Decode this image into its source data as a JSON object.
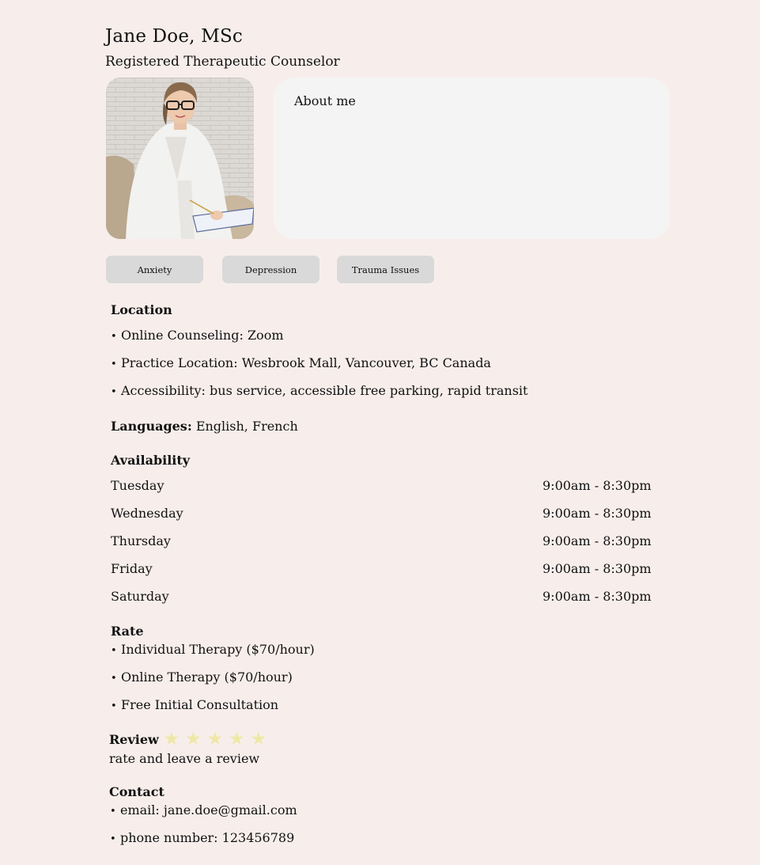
{
  "header": {
    "name": "Jane Doe, MSc",
    "title": "Registered Therapeutic Counselor"
  },
  "about": {
    "heading": "About me"
  },
  "tags": [
    "Anxiety",
    "Depression",
    "Trauma Issues"
  ],
  "location": {
    "heading": "Location",
    "items": [
      "Online Counseling: Zoom",
      "Practice Location: Wesbrook Mall, Vancouver, BC Canada",
      "Accessibility: bus service, accessible free parking, rapid transit"
    ]
  },
  "languages": {
    "label": "Languages:",
    "value": "English, French"
  },
  "availability": {
    "heading": "Availability",
    "rows": [
      {
        "day": "Tuesday",
        "hours": "9:00am - 8:30pm"
      },
      {
        "day": "Wednesday",
        "hours": "9:00am - 8:30pm"
      },
      {
        "day": "Thursday",
        "hours": "9:00am - 8:30pm"
      },
      {
        "day": "Friday",
        "hours": "9:00am - 8:30pm"
      },
      {
        "day": "Saturday",
        "hours": "9:00am - 8:30pm"
      }
    ]
  },
  "rate": {
    "heading": "Rate",
    "items": [
      "Individual Therapy ($70/hour)",
      "Online Therapy ($70/hour)",
      "Free Initial Consultation"
    ]
  },
  "review": {
    "heading": "Review",
    "star_glyph": "★",
    "star_count": 5,
    "star_color": "#efe7a6",
    "link": "rate and leave a review"
  },
  "contact": {
    "heading": "Contact",
    "items": [
      "email: jane.doe@gmail.com",
      "phone number: 123456789"
    ]
  },
  "colors": {
    "background": "#f7eeeb",
    "card": "#f4f4f4",
    "tag": "#d9d9d9"
  }
}
